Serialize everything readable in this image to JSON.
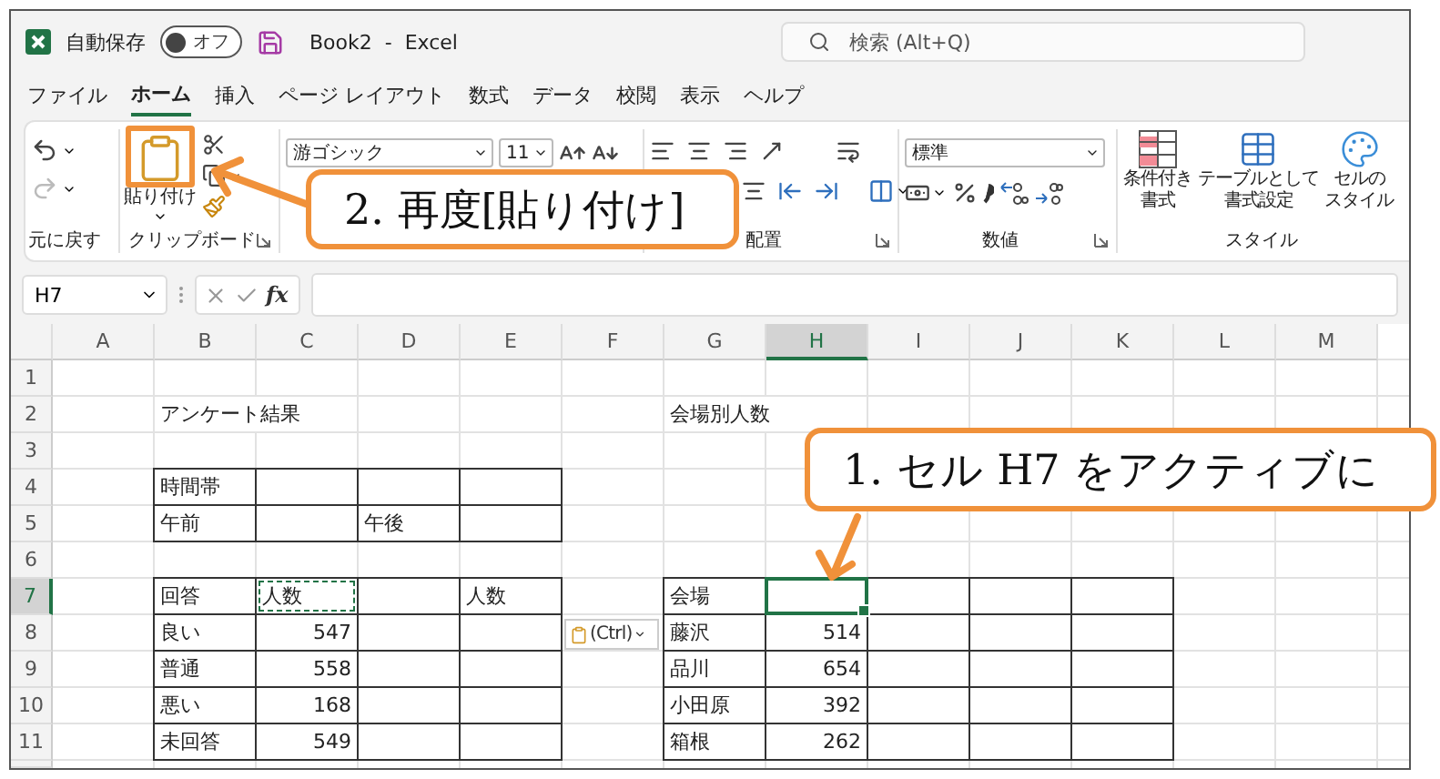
{
  "title_bar": {
    "autosave_label": "自動保存",
    "autosave_toggle": {
      "on": false,
      "label": "オフ"
    },
    "document_title": "Book2  -  Excel",
    "search": {
      "placeholder": "検索 (Alt+Q)"
    }
  },
  "menu_tabs": [
    {
      "label": "ファイル",
      "selected": false
    },
    {
      "label": "ホーム",
      "selected": true
    },
    {
      "label": "挿入",
      "selected": false
    },
    {
      "label": "ページ レイアウト",
      "selected": false
    },
    {
      "label": "数式",
      "selected": false
    },
    {
      "label": "データ",
      "selected": false
    },
    {
      "label": "校閲",
      "selected": false
    },
    {
      "label": "表示",
      "selected": false
    },
    {
      "label": "ヘルプ",
      "selected": false
    }
  ],
  "ribbon": {
    "undo": {
      "label": "元に戻す"
    },
    "clipboard": {
      "label": "クリップボード",
      "paste_label": "貼り付け",
      "highlighted": true
    },
    "font": {
      "font_name": "游ゴシック",
      "font_size": "11"
    },
    "alignment": {
      "label": "配置"
    },
    "number": {
      "label": "数値",
      "format": "標準"
    },
    "styles": {
      "label": "スタイル",
      "buttons": [
        {
          "lines": [
            "条件付き",
            "書式"
          ]
        },
        {
          "lines": [
            "テーブルとして",
            "書式設定"
          ]
        },
        {
          "lines": [
            "セルの",
            "スタイル"
          ]
        }
      ]
    }
  },
  "formula_bar": {
    "name_box": "H7",
    "function_label": "fx"
  },
  "sheet": {
    "columns": [
      "A",
      "B",
      "C",
      "D",
      "E",
      "F",
      "G",
      "H",
      "I",
      "J",
      "K",
      "L",
      "M"
    ],
    "row_numbers": [
      "1",
      "2",
      "3",
      "4",
      "5",
      "6",
      "7",
      "8",
      "9",
      "10",
      "11"
    ],
    "labels": [
      {
        "text": "アンケート結果"
      },
      {
        "text": "会場別人数"
      }
    ],
    "tables": [
      {
        "rows": [
          [
            {
              "kind": "text",
              "text": "時間帯"
            },
            {
              "kind": "empty"
            },
            {
              "kind": "empty"
            },
            {
              "kind": "empty"
            }
          ],
          [
            {
              "kind": "text",
              "text": "午前"
            },
            {
              "kind": "empty"
            },
            {
              "kind": "text",
              "text": "午後"
            },
            {
              "kind": "empty"
            }
          ]
        ]
      },
      {
        "rows": [
          [
            {
              "kind": "text",
              "text": "回答"
            },
            {
              "kind": "text",
              "text": "人数",
              "copied": true
            },
            {
              "kind": "empty"
            },
            {
              "kind": "text",
              "text": "人数"
            }
          ],
          [
            {
              "kind": "text",
              "text": "良い"
            },
            {
              "kind": "number",
              "text": "547"
            },
            {
              "kind": "empty"
            },
            {
              "kind": "empty"
            }
          ],
          [
            {
              "kind": "text",
              "text": "普通"
            },
            {
              "kind": "number",
              "text": "558"
            },
            {
              "kind": "empty"
            },
            {
              "kind": "empty"
            }
          ],
          [
            {
              "kind": "text",
              "text": "悪い"
            },
            {
              "kind": "number",
              "text": "168"
            },
            {
              "kind": "empty"
            },
            {
              "kind": "empty"
            }
          ],
          [
            {
              "kind": "text",
              "text": "未回答"
            },
            {
              "kind": "number",
              "text": "549"
            },
            {
              "kind": "empty"
            },
            {
              "kind": "empty"
            }
          ]
        ]
      },
      {
        "rows": [
          [
            {
              "kind": "text",
              "text": "会場"
            },
            {
              "kind": "empty",
              "active": true
            },
            {
              "kind": "empty"
            },
            {
              "kind": "empty"
            },
            {
              "kind": "empty"
            }
          ],
          [
            {
              "kind": "text",
              "text": "藤沢"
            },
            {
              "kind": "number",
              "text": "514"
            },
            {
              "kind": "empty"
            },
            {
              "kind": "empty"
            },
            {
              "kind": "empty"
            }
          ],
          [
            {
              "kind": "text",
              "text": "品川"
            },
            {
              "kind": "number",
              "text": "654"
            },
            {
              "kind": "empty"
            },
            {
              "kind": "empty"
            },
            {
              "kind": "empty"
            }
          ],
          [
            {
              "kind": "text",
              "text": "小田原"
            },
            {
              "kind": "number",
              "text": "392"
            },
            {
              "kind": "empty"
            },
            {
              "kind": "empty"
            },
            {
              "kind": "empty"
            }
          ],
          [
            {
              "kind": "text",
              "text": "箱根"
            },
            {
              "kind": "number",
              "text": "262"
            },
            {
              "kind": "empty"
            },
            {
              "kind": "empty"
            },
            {
              "kind": "empty"
            }
          ]
        ]
      }
    ]
  },
  "paste_options": {
    "label": "(Ctrl)"
  },
  "callouts": [
    {
      "text": "1. セル H7 をアクティブに"
    },
    {
      "text": "2. 再度[貼り付け]"
    }
  ]
}
